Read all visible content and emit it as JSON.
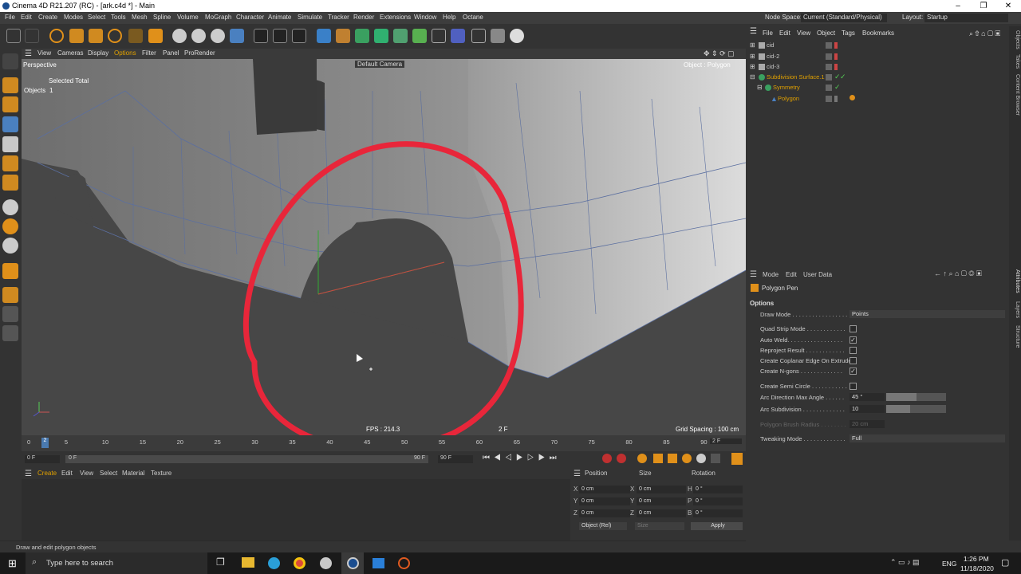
{
  "window": {
    "title": "Cinema 4D R21.207 (RC) - [ark.c4d *] - Main",
    "min": "–",
    "max": "❐",
    "close": "✕"
  },
  "menubar": {
    "items": [
      "File",
      "Edit",
      "Create",
      "Modes",
      "Select",
      "Tools",
      "Mesh",
      "Spline",
      "Volume",
      "MoGraph",
      "Character",
      "Animate",
      "Simulate",
      "Tracker",
      "Render",
      "Extensions",
      "Window",
      "Help",
      "Octane"
    ],
    "node_space_label": "Node Space:",
    "node_space_value": "Current (Standard/Physical)",
    "layout_label": "Layout:",
    "layout_value": "Startup"
  },
  "viewport": {
    "menu": [
      "View",
      "Cameras",
      "Display",
      "Options",
      "Filter",
      "Panel",
      "ProRender"
    ],
    "name": "Perspective",
    "camera": "Default Camera",
    "object_label": "Object : Polygon",
    "selected_total": "Selected Total",
    "objects_label": "Objects",
    "objects_count": "1",
    "fps": "FPS : 214.3",
    "frame": "2 F",
    "grid_spacing": "Grid Spacing : 100 cm"
  },
  "timeline": {
    "ticks": [
      "0",
      "5",
      "10",
      "15",
      "20",
      "25",
      "30",
      "35",
      "40",
      "45",
      "50",
      "55",
      "60",
      "65",
      "70",
      "75",
      "80",
      "85",
      "90"
    ],
    "current_marker": "2",
    "current_frame": "2 F"
  },
  "playbar": {
    "start": "0 F",
    "range_start": "0 F",
    "range_end": "90 F",
    "end": "90 F"
  },
  "material_manager": {
    "menu": [
      "Create",
      "Edit",
      "View",
      "Select",
      "Material",
      "Texture"
    ]
  },
  "coordinates": {
    "headers": [
      "Position",
      "Size",
      "Rotation"
    ],
    "rows": [
      {
        "axis": "X",
        "pos": "0 cm",
        "size_axis": "X",
        "size": "0 cm",
        "rot_axis": "H",
        "rot": "0 °"
      },
      {
        "axis": "Y",
        "pos": "0 cm",
        "size_axis": "Y",
        "size": "0 cm",
        "rot_axis": "P",
        "rot": "0 °"
      },
      {
        "axis": "Z",
        "pos": "0 cm",
        "size_axis": "Z",
        "size": "0 cm",
        "rot_axis": "B",
        "rot": "0 °"
      }
    ],
    "mode": "Object (Rel)",
    "size_mode": "Size",
    "apply": "Apply"
  },
  "status": {
    "text": "Draw and edit polygon objects"
  },
  "object_manager": {
    "menu": [
      "File",
      "Edit",
      "View",
      "Object",
      "Tags",
      "Bookmarks"
    ],
    "objects": [
      {
        "name": "cid",
        "color": "#c8c8c8"
      },
      {
        "name": "cid-2",
        "color": "#c8c8c8"
      },
      {
        "name": "cid-3",
        "color": "#c8c8c8"
      },
      {
        "name": "Subdivision Surface.1",
        "color": "#e0a000"
      },
      {
        "name": "Symmetry",
        "color": "#e0a000"
      },
      {
        "name": "Polygon",
        "color": "#e0a000"
      }
    ]
  },
  "attributes": {
    "menu": [
      "Mode",
      "Edit",
      "User Data"
    ],
    "tool_name": "Polygon Pen",
    "section": "Options",
    "draw_mode_label": "Draw Mode . . . . . . . . . . . . . . . . .",
    "draw_mode_value": "Points",
    "checks": [
      {
        "label": "Quad Strip Mode . . . . . . . . . . . .",
        "checked": false
      },
      {
        "label": "Auto Weld. . . . . . . . . . . . . . . . .",
        "checked": true
      },
      {
        "label": "Reproject Result . . . . . . . . . . . .",
        "checked": false
      },
      {
        "label": "Create Coplanar Edge On Extrude",
        "checked": false
      },
      {
        "label": "Create N-gons . . . . . . . . . . . . .",
        "checked": true
      }
    ],
    "semi_circle_label": "Create Semi Circle . . . . . . . . . . .",
    "arc_angle_label": "Arc Direction Max Angle . . . . . .",
    "arc_angle_value": "45 °",
    "arc_angle_level": 0.5,
    "arc_sub_label": "Arc Subdivision . . . . . . . . . . . . .",
    "arc_sub_value": "10",
    "arc_sub_level": 0.4,
    "brush_label": "Polygon Brush Radius . . . . . . . .",
    "brush_value": "20 cm",
    "tweak_label": "Tweaking Mode . . . . . . . . . . . . .",
    "tweak_value": "Full"
  },
  "right_tabs": [
    "Objects",
    "Takes",
    "Content Browser",
    "Attributes",
    "Layers",
    "Structure"
  ],
  "taskbar": {
    "search": "Type here to search",
    "lang": "ENG",
    "time": "1:26 PM",
    "date": "11/18/2020"
  }
}
